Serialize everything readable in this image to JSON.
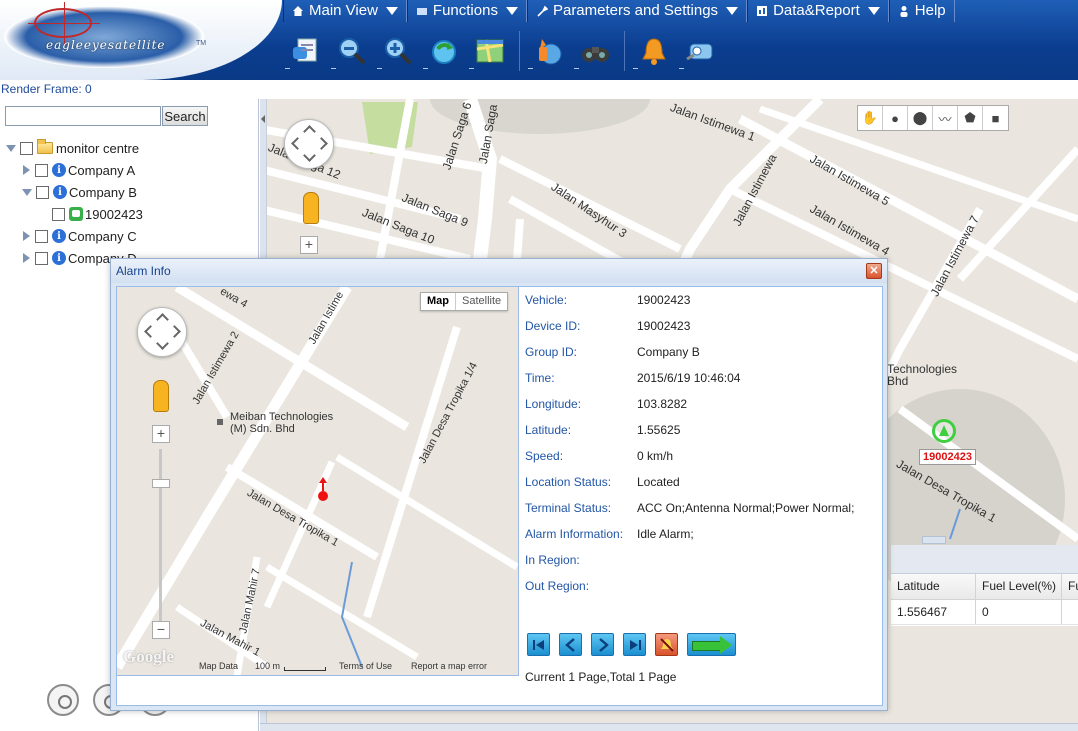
{
  "header": {
    "logo_text": "eagleeyesatellite",
    "logo_tm": "TM",
    "menu": [
      {
        "label": "Main View",
        "icon": "home-icon",
        "has_dropdown": true
      },
      {
        "label": "Functions",
        "icon": "",
        "has_dropdown": true
      },
      {
        "label": "Parameters and Settings",
        "icon": "wrench-icon",
        "has_dropdown": true
      },
      {
        "label": "Data&Report",
        "icon": "report-icon",
        "has_dropdown": true
      },
      {
        "label": "Help",
        "icon": "user-icon",
        "has_dropdown": false
      }
    ],
    "toolbar_icons": [
      "vehicle-list-icon",
      "zoom-out-icon",
      "zoom-in-icon",
      "refresh-icon",
      "map-view-icon",
      "fire-alarm-icon",
      "binoculars-icon",
      "bell-icon",
      "speed-camera-icon"
    ]
  },
  "render_frame": "Render Frame: 0",
  "sidebar": {
    "search_placeholder": "",
    "search_button": "Search",
    "tree": {
      "root": "monitor centre",
      "companies": [
        {
          "label": "Company A",
          "expanded": false,
          "vehicles": []
        },
        {
          "label": "Company B",
          "expanded": true,
          "vehicles": [
            "19002423"
          ]
        },
        {
          "label": "Company C",
          "expanded": false,
          "vehicles": []
        },
        {
          "label": "Company D",
          "expanded": false,
          "vehicles": []
        }
      ]
    }
  },
  "map": {
    "tools": [
      "hand-icon",
      "pin-icon",
      "circle-icon",
      "polyline-icon",
      "polygon-icon",
      "rectangle-icon"
    ],
    "streets": [
      "Jalan Istimewa 1",
      "Jalan Saga 12",
      "Jalan Saga 9",
      "Jalan Saga 10",
      "Jalan Masyhur 3",
      "Jalan Istimewa",
      "Jalan Istimewa 5",
      "Jalan Istimewa 4",
      "Jalan Istimewa 7",
      "Jalan Saga 6",
      "Jalan Saga",
      "Jalan Desa Tropika 1"
    ],
    "place": "Technologies\nBhd",
    "vehicle_label": "19002423",
    "table": {
      "columns": [
        "Latitude",
        "Fuel Level(%)",
        "Fu"
      ],
      "rows": [
        [
          "1.556467",
          "0",
          ""
        ]
      ]
    }
  },
  "alarm_dialog": {
    "title": "Alarm Info",
    "close": "✕",
    "map_type": {
      "active": "Map",
      "inactive": "Satellite"
    },
    "mini_map_streets": [
      "Jalan Istime",
      "Jalan Istimewa 2",
      "Jalan Desa Tropika 1/4",
      "Jalan Desa Tropika 1",
      "Jalan Mahir 7",
      "Jalan Mahir 1",
      "ewa 4"
    ],
    "mini_map_place": "Meiban Technologies\n(M) Sdn. Bhd",
    "footer": {
      "google": "Google",
      "map_data": "Map Data",
      "scale": "100 m",
      "terms": "Terms of Use",
      "report": "Report a map error"
    },
    "fields": [
      {
        "label": "Vehicle:",
        "value": "19002423"
      },
      {
        "label": "Device ID:",
        "value": "19002423"
      },
      {
        "label": "Group ID:",
        "value": "Company B"
      },
      {
        "label": "Time:",
        "value": "2015/6/19 10:46:04"
      },
      {
        "label": "Longitude:",
        "value": "103.8282"
      },
      {
        "label": "Latitude:",
        "value": "1.55625"
      },
      {
        "label": "Speed:",
        "value": "0 km/h"
      },
      {
        "label": "Location Status:",
        "value": "Located"
      },
      {
        "label": "Terminal Status:",
        "value": "ACC On;Antenna Normal;Power Normal;"
      },
      {
        "label": "Alarm Information:",
        "value": "Idle Alarm;"
      },
      {
        "label": "In Region:",
        "value": ""
      },
      {
        "label": "Out Region:",
        "value": ""
      }
    ],
    "playback_buttons": [
      "first-page-icon",
      "prev-page-icon",
      "next-page-icon",
      "last-page-icon",
      "mute-alarm-icon",
      "go-arrow-icon"
    ],
    "paging": "Current 1 Page,Total 1 Page"
  }
}
